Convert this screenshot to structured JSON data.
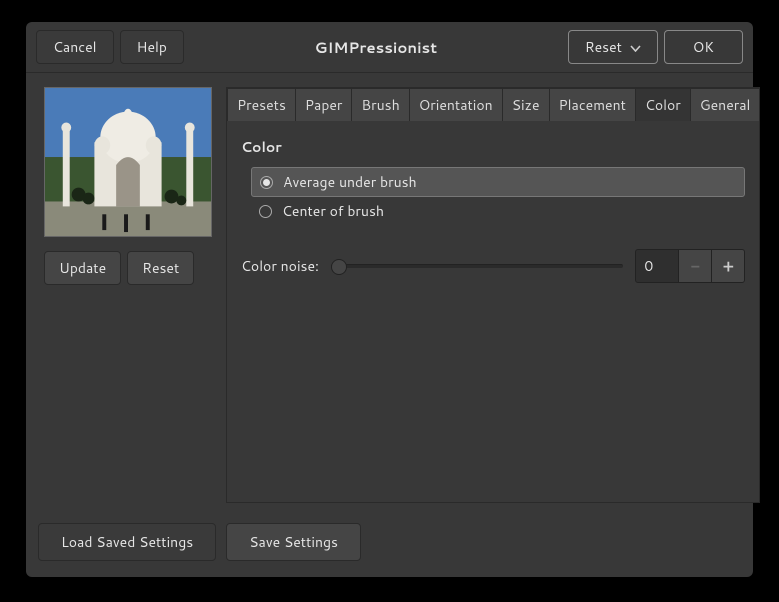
{
  "header": {
    "cancel": "Cancel",
    "help": "Help",
    "title": "GIMPressionist",
    "reset": "Reset",
    "ok": "OK"
  },
  "preview": {
    "update": "Update",
    "reset": "Reset"
  },
  "tabs": [
    "Presets",
    "Paper",
    "Brush",
    "Orientation",
    "Size",
    "Placement",
    "Color",
    "General"
  ],
  "active_tab": "Color",
  "color": {
    "section": "Color",
    "opt_avg": "Average under brush",
    "opt_center": "Center of brush",
    "noise_label": "Color noise:",
    "noise_value": "0"
  },
  "footer": {
    "load": "Load Saved Settings",
    "save": "Save Settings"
  }
}
